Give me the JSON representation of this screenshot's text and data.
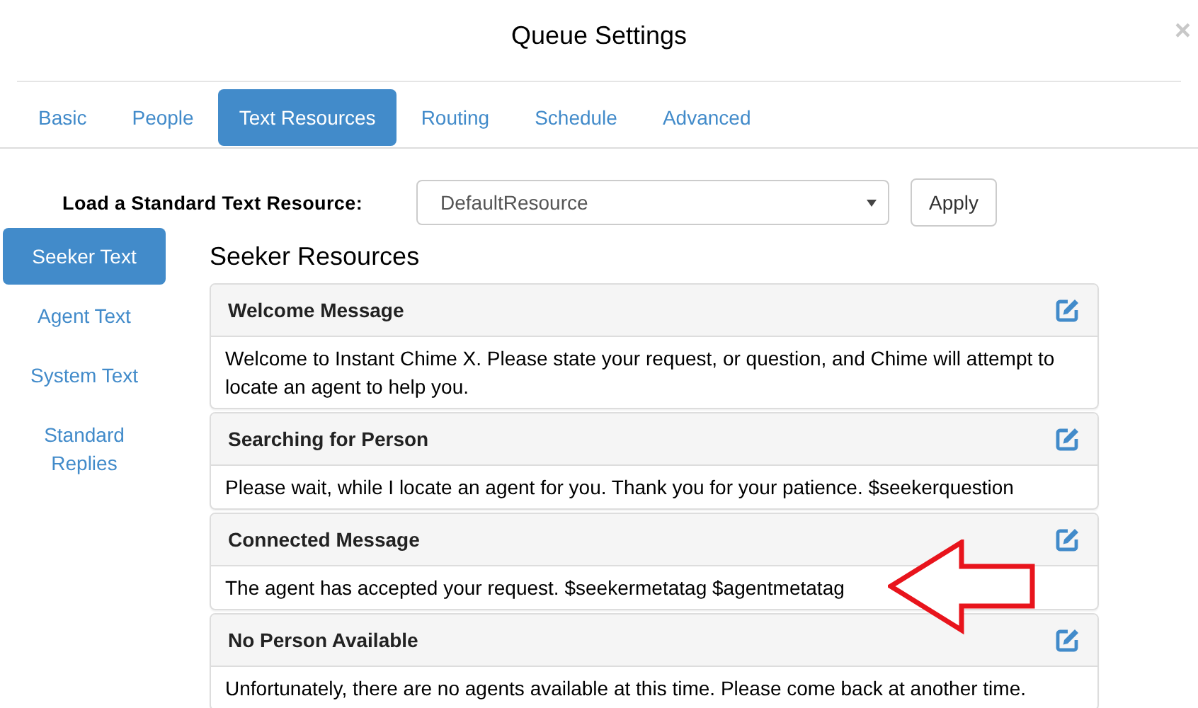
{
  "dialog": {
    "title": "Queue Settings",
    "close": "×"
  },
  "tabs": [
    {
      "label": "Basic",
      "selected": false
    },
    {
      "label": "People",
      "selected": false
    },
    {
      "label": "Text Resources",
      "selected": true
    },
    {
      "label": "Routing",
      "selected": false
    },
    {
      "label": "Schedule",
      "selected": false
    },
    {
      "label": "Advanced",
      "selected": false
    }
  ],
  "load": {
    "label": "Load a Standard Text Resource:",
    "value": "DefaultResource",
    "button": "Apply"
  },
  "sidebar": {
    "items": [
      {
        "label": "Seeker Text",
        "selected": true
      },
      {
        "label": "Agent Text",
        "selected": false
      },
      {
        "label": "System Text",
        "selected": false
      },
      {
        "label": "Standard Replies",
        "selected": false
      }
    ]
  },
  "section": {
    "title": "Seeker Resources",
    "panels": [
      {
        "title": "Welcome Message",
        "text": "Welcome to Instant Chime X. Please state your request, or question, and Chime will attempt to locate an agent to help you."
      },
      {
        "title": "Searching for Person",
        "text": "Please wait, while I locate an agent for you. Thank you for your patience. $seekerquestion"
      },
      {
        "title": "Connected Message",
        "text": "The agent has accepted your request. $seekermetatag $agentmetatag"
      },
      {
        "title": "No Person Available",
        "text": "Unfortunately, there are no agents available at this time. Please come back at another time."
      }
    ]
  }
}
